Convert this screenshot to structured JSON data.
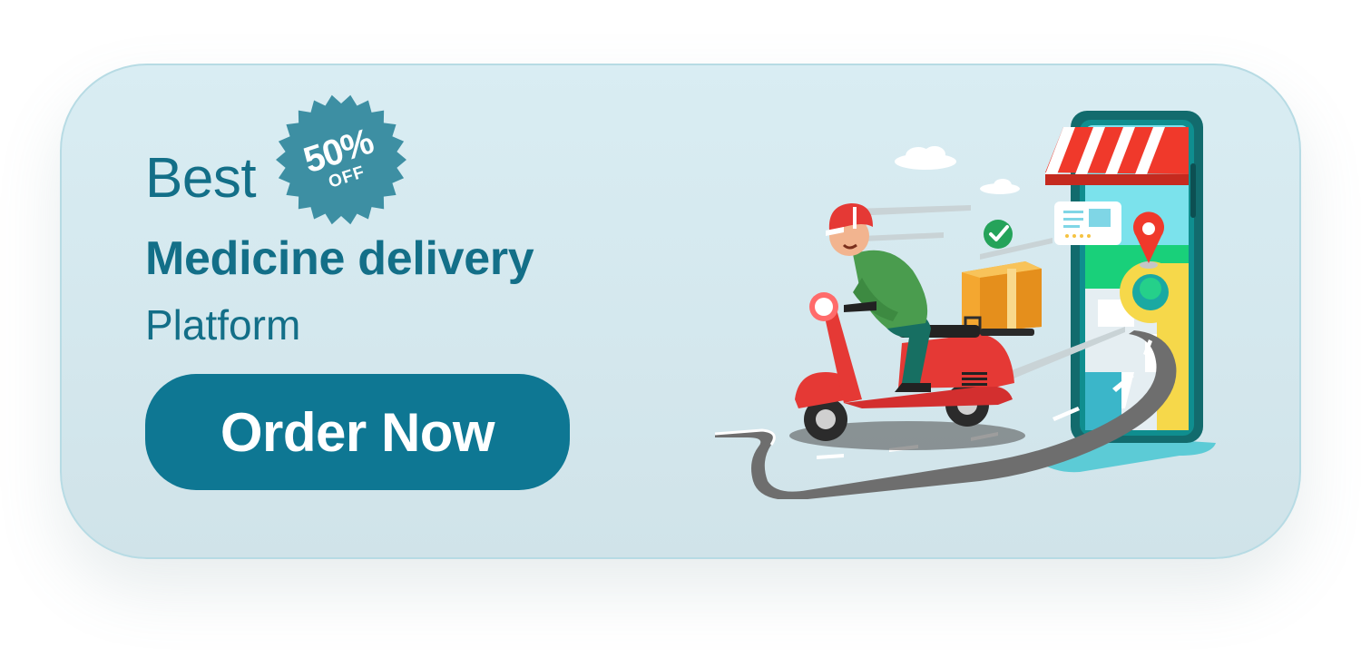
{
  "banner": {
    "headline_prefix": "Best",
    "headline_main": "Medicine delivery",
    "headline_sub": "Platform",
    "cta_label": "Order Now",
    "badge": {
      "percent": "50%",
      "label": "OFF"
    }
  },
  "colors": {
    "brand_teal": "#0e7793",
    "text_teal": "#136f88",
    "badge_teal": "#3d8fa3",
    "banner_bg": "#d4e7ed"
  },
  "icons": [
    "discount-badge-icon",
    "delivery-scooter-illustration",
    "map-pin-icon",
    "check-icon",
    "parcel-icon",
    "shop-awning-icon"
  ]
}
